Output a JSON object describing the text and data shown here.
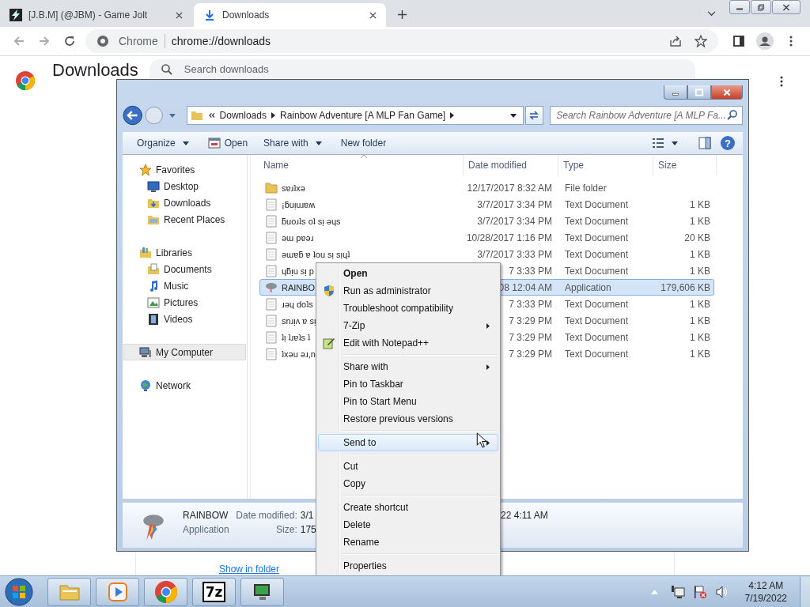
{
  "browser": {
    "tabs": [
      {
        "title": "[J.B.M] (@JBM) - Game Jolt",
        "kind": "bolt",
        "selected": false
      },
      {
        "title": "Downloads",
        "kind": "download",
        "selected": true
      }
    ],
    "omnibox": {
      "site": "Chrome",
      "url": "chrome://downloads"
    },
    "page": {
      "title": "Downloads",
      "search_placeholder": "Search downloads",
      "link": "Show in folder"
    }
  },
  "explorer": {
    "breadcrumb": [
      "Downloads",
      "Rainbow Adventure [A MLP Fan Game]"
    ],
    "search_placeholder": "Search Rainbow Adventure [A MLP Fa...",
    "toolbar": [
      {
        "label": "Organize",
        "kind": "text",
        "dropdown": true
      },
      {
        "label": "Open",
        "kind": "app",
        "dropdown": false
      },
      {
        "label": "Share with",
        "kind": "text",
        "dropdown": true
      },
      {
        "label": "New folder",
        "kind": "text",
        "dropdown": false
      }
    ],
    "help": "?",
    "nav": [
      {
        "label": "Favorites",
        "kind": "favorites",
        "selected": false,
        "children": [
          {
            "label": "Desktop",
            "kind": "desktop",
            "selected": false
          },
          {
            "label": "Downloads",
            "kind": "downloads",
            "selected": false
          },
          {
            "label": "Recent Places",
            "kind": "recent",
            "selected": false
          }
        ]
      },
      {
        "label": "Libraries",
        "kind": "libraries",
        "selected": false,
        "children": [
          {
            "label": "Documents",
            "kind": "documents",
            "selected": false
          },
          {
            "label": "Music",
            "kind": "music",
            "selected": false
          },
          {
            "label": "Pictures",
            "kind": "pictures",
            "selected": false
          },
          {
            "label": "Videos",
            "kind": "videos",
            "selected": false
          }
        ]
      },
      {
        "label": "My Computer",
        "kind": "computer",
        "selected": true
      },
      {
        "label": "Network",
        "kind": "network",
        "selected": false
      }
    ],
    "columns": [
      {
        "label": "Name",
        "sorted": true
      },
      {
        "label": "Date modified",
        "sorted": false
      },
      {
        "label": "Type",
        "sorted": false
      },
      {
        "label": "Size",
        "sorted": false
      }
    ],
    "files": [
      {
        "name": "sɐɹʇxǝ",
        "date": "12/17/2017 8:32 AM",
        "type": "File folder",
        "kind": "folder",
        "selected": false
      },
      {
        "name": "¡ƃuᴉuɹɐʍ",
        "date": "3/7/2017 3:34 PM",
        "type": "Text Document",
        "size": "1 KB",
        "kind": "text",
        "selected": false
      },
      {
        "name": "ƃuoɹʇs oʇ sᴉ ǝɥs",
        "date": "3/7/2017 3:34 PM",
        "type": "Text Document",
        "size": "1 KB",
        "kind": "text",
        "selected": false
      },
      {
        "name": "ǝɯ pɐǝɹ",
        "date": "10/28/2017 1:16 PM",
        "type": "Text Document",
        "size": "20 KB",
        "kind": "text",
        "selected": false
      },
      {
        "name": "ǝɯɐƃ ɐ ʇou sᴉ sᴉɥʇ",
        "date": "3/7/2017 3:33 PM",
        "type": "Text Document",
        "size": "1 KB",
        "kind": "text",
        "selected": false
      },
      {
        "name": "ɥƃᴉu sᴉ p",
        "date": "7 3:33 PM",
        "type": "Text Document",
        "size": "1 KB",
        "kind": "text",
        "selected": false
      },
      {
        "name": "RAINBO",
        "date": "08 12:04 AM",
        "type": "Application",
        "size": "179,606 KB",
        "kind": "app",
        "selected": true
      },
      {
        "name": "ɹǝɥ doʇs",
        "date": "7 3:33 PM",
        "type": "Text Document",
        "size": "1 KB",
        "kind": "text",
        "selected": false
      },
      {
        "name": "snɹᴉʌ ɐ sᴉ",
        "date": "7 3:29 PM",
        "type": "Text Document",
        "size": "1 KB",
        "kind": "text",
        "selected": false
      },
      {
        "name": "ʇᴉ ʇɹɐʇs ʇ",
        "date": "7 3:29 PM",
        "type": "Text Document",
        "size": "1 KB",
        "kind": "text",
        "selected": false
      },
      {
        "name": "ʇxǝu ǝɹ,n",
        "date": "7 3:29 PM",
        "type": "Text Document",
        "size": "1 KB",
        "kind": "text",
        "selected": false
      }
    ],
    "details": {
      "name": "RAINBOW",
      "type": "Application",
      "date_label": "Date modified:",
      "date_value": "3/1",
      "size_label": "Size:",
      "size_value": "175",
      "created_tail": "22 4:11 AM"
    }
  },
  "context_menu": [
    {
      "kind": "item",
      "label": "Open",
      "default": true,
      "submenu": false,
      "selected": false
    },
    {
      "kind": "shield",
      "label": "Run as administrator",
      "default": false,
      "submenu": false,
      "selected": false
    },
    {
      "kind": "item",
      "label": "Troubleshoot compatibility",
      "default": false,
      "submenu": false,
      "selected": false
    },
    {
      "kind": "item",
      "label": "7-Zip",
      "default": false,
      "submenu": true,
      "selected": false
    },
    {
      "kind": "notepad",
      "label": "Edit with Notepad++",
      "default": false,
      "submenu": false,
      "selected": false
    },
    {
      "kind": "separator"
    },
    {
      "kind": "item",
      "label": "Share with",
      "default": false,
      "submenu": true,
      "selected": false
    },
    {
      "kind": "item",
      "label": "Pin to Taskbar",
      "default": false,
      "submenu": false,
      "selected": false
    },
    {
      "kind": "item",
      "label": "Pin to Start Menu",
      "default": false,
      "submenu": false,
      "selected": false
    },
    {
      "kind": "item",
      "label": "Restore previous versions",
      "default": false,
      "submenu": false,
      "selected": false
    },
    {
      "kind": "separator"
    },
    {
      "kind": "item",
      "label": "Send to",
      "default": false,
      "submenu": true,
      "selected": true
    },
    {
      "kind": "separator"
    },
    {
      "kind": "item",
      "label": "Cut",
      "default": false,
      "submenu": false,
      "selected": false
    },
    {
      "kind": "item",
      "label": "Copy",
      "default": false,
      "submenu": false,
      "selected": false
    },
    {
      "kind": "separator"
    },
    {
      "kind": "item",
      "label": "Create shortcut",
      "default": false,
      "submenu": false,
      "selected": false
    },
    {
      "kind": "item",
      "label": "Delete",
      "default": false,
      "submenu": false,
      "selected": false
    },
    {
      "kind": "item",
      "label": "Rename",
      "default": false,
      "submenu": false,
      "selected": false
    },
    {
      "kind": "separator"
    },
    {
      "kind": "item",
      "label": "Properties",
      "default": false,
      "submenu": false,
      "selected": false
    }
  ],
  "taskbar": {
    "apps": [
      {
        "kind": "folder"
      },
      {
        "kind": "player"
      },
      {
        "kind": "browser"
      },
      {
        "kind": "archiver",
        "label": "7z"
      },
      {
        "kind": "monitor"
      }
    ],
    "time": "4:12 AM",
    "date": "7/19/2022"
  }
}
